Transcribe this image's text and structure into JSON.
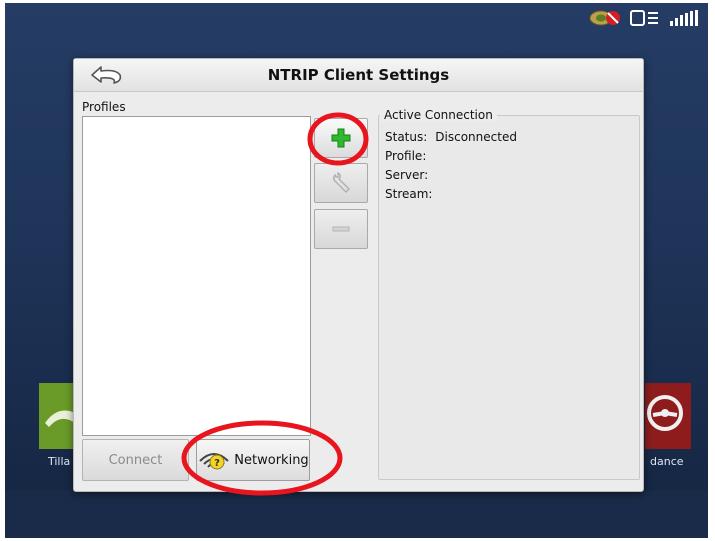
{
  "dialog": {
    "title": "NTRIP Client Settings",
    "back_icon": "back-arrow-icon"
  },
  "profiles": {
    "label": "Profiles",
    "items": []
  },
  "side_buttons": {
    "add_icon": "plus-icon",
    "edit_icon": "wrench-icon",
    "remove_icon": "minus-icon"
  },
  "connection": {
    "legend": "Active Connection",
    "status_label": "Status:",
    "status_value": "Disconnected",
    "profile_label": "Profile:",
    "profile_value": "",
    "server_label": "Server:",
    "server_value": "",
    "stream_label": "Stream:",
    "stream_value": ""
  },
  "bottom_buttons": {
    "connect_label": "Connect",
    "networking_label": "Networking",
    "networking_icon": "wifi-question-icon"
  },
  "background": {
    "left_tile_caption": "Tilla",
    "right_tile_caption": "dance"
  },
  "status_bar": {
    "icons": [
      "gps-disabled-icon",
      "display-menu-icon",
      "satellite-signal-icon"
    ]
  },
  "colors": {
    "highlight": "#e8141e",
    "add_green": "#2dbb2d"
  }
}
